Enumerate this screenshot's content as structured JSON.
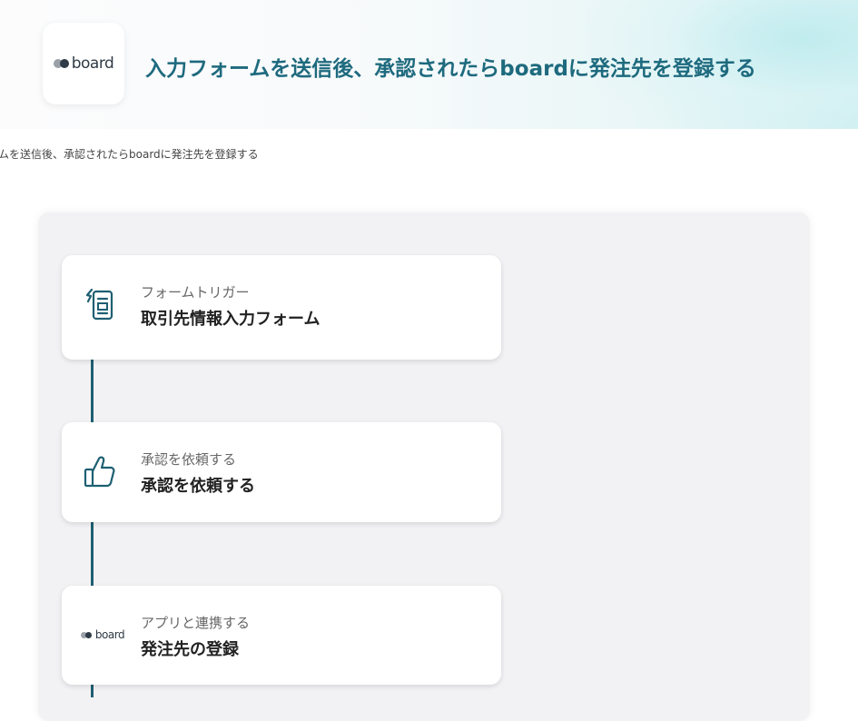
{
  "header": {
    "title": "入力フォームを送信後、承認されたらboardに発注先を登録する",
    "app_logo_text": "board"
  },
  "breadcrumb": {
    "text": "ムを送信後、承認されたらboardに発注先を登録する"
  },
  "flow": {
    "steps": [
      {
        "subtitle": "フォームトリガー",
        "title": "取引先情報入力フォーム",
        "icon": "form-icon"
      },
      {
        "subtitle": "承認を依頼する",
        "title": "承認を依頼する",
        "icon": "thumbs-up-icon"
      },
      {
        "subtitle": "アプリと連携する",
        "title": "発注先の登録",
        "icon": "board-logo-icon",
        "logo_text": "board"
      }
    ]
  },
  "colors": {
    "title": "#1e6a7e",
    "connector": "#1e5f72",
    "panel": "#f2f2f4"
  }
}
